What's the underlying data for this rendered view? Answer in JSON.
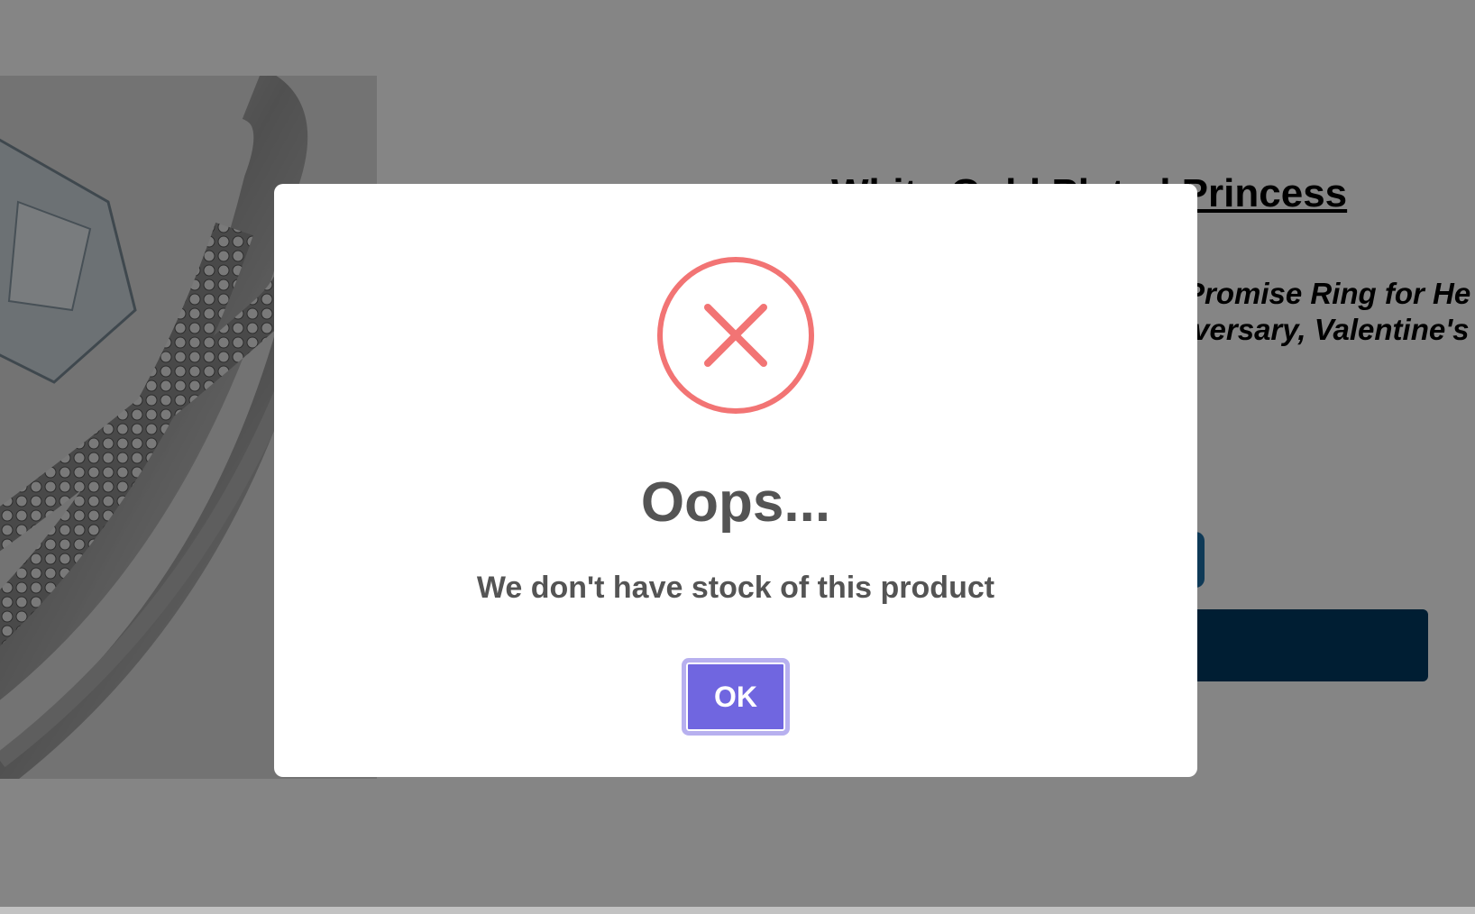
{
  "product": {
    "title": "White Gold Plated Princess",
    "subtitle_line1": "Promise Ring for He",
    "subtitle_line2": "iversary, Valentine's",
    "image_icon": "diamond-ring-image"
  },
  "modal": {
    "icon": "error-x-circle-icon",
    "title": "Oops...",
    "text": "We don't have stock of this product",
    "confirm_label": "OK"
  },
  "colors": {
    "backdrop": "#808183",
    "error_icon": "#f27474",
    "modal_text": "#545454",
    "confirm_button": "#7066e0",
    "confirm_button_focus_ring": "#b7b0ef",
    "primary_button": "#1e6fa8",
    "dark_button": "#003a63"
  }
}
